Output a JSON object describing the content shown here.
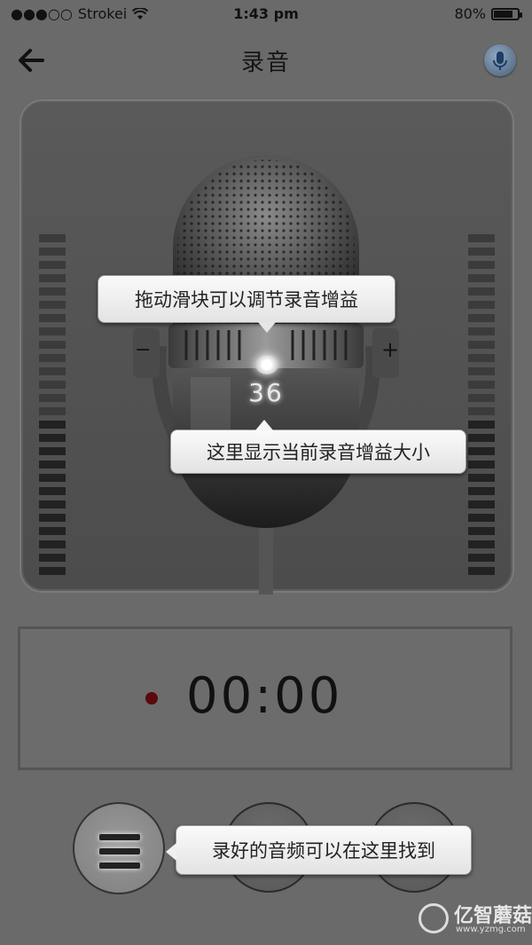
{
  "status": {
    "signal": "●●●○○",
    "carrier": "Strokei",
    "time": "1:43 pm",
    "battery": "80%",
    "battery_level": 0.8
  },
  "nav": {
    "title": "录音",
    "back_icon": "back-arrow-icon",
    "mic_icon": "microphone-icon"
  },
  "mic": {
    "gain_value": "36",
    "minus": "−",
    "plus": "+"
  },
  "tips": {
    "drag_slider": "拖动滑块可以调节录音增益",
    "gain_display": "这里显示当前录音增益大小",
    "find_audio": "录好的音频可以在这里找到"
  },
  "timer": {
    "value": "00:00"
  },
  "watermark": {
    "brand": "亿智蘑菇",
    "url": "www.yzmg.com"
  }
}
